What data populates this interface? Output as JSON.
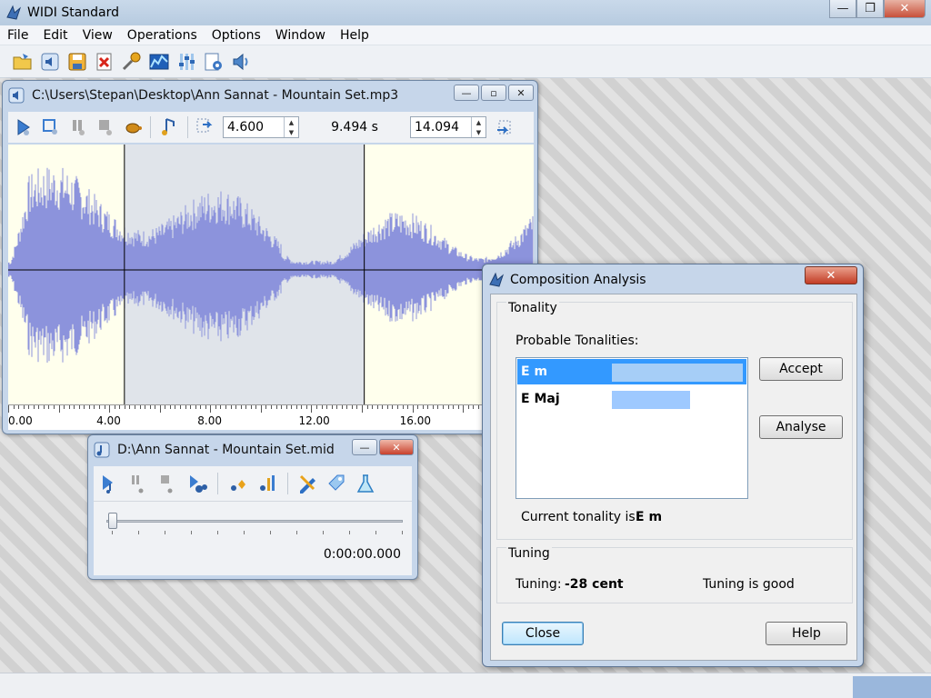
{
  "app": {
    "title": "WIDI Standard"
  },
  "window_buttons": {
    "minimize": "—",
    "maximize": "❐",
    "close": "✕"
  },
  "menu": [
    "File",
    "Edit",
    "View",
    "Operations",
    "Options",
    "Window",
    "Help"
  ],
  "toolbar_icons": [
    "open-folder-icon",
    "audio-speaker-icon",
    "save-icon",
    "delete-icon",
    "microphone-icon",
    "spectrum-icon",
    "equalizer-icon",
    "settings-doc-icon",
    "volume-icon"
  ],
  "audio_window": {
    "title": "C:\\Users\\Stepan\\Desktop\\Ann Sannat - Mountain Set.mp3",
    "start_value": "4.600",
    "duration_text": "9.494 s",
    "end_value": "14.094",
    "selection": {
      "start": 4.6,
      "end": 14.094,
      "max": 20.8
    },
    "ruler_labels": [
      "0.00",
      "4.00",
      "8.00",
      "12.00",
      "16.00"
    ],
    "ruler_label_values": [
      0,
      4,
      8,
      12,
      16
    ]
  },
  "midi_window": {
    "title": "D:\\Ann Sannat - Mountain Set.mid",
    "time": "0:00:00.000",
    "position": 0
  },
  "composition_dialog": {
    "title": "Composition Analysis",
    "close_glyph": "✕",
    "tonality_group": "Tonality",
    "probable_label": "Probable Tonalities:",
    "tonalities": [
      {
        "name": "E m",
        "score": 1.0,
        "selected": true
      },
      {
        "name": "E Maj",
        "score": 0.6,
        "selected": false
      }
    ],
    "accept_label": "Accept",
    "analyse_label": "Analyse",
    "current_label": "Current tonality is:",
    "current_value": "E m",
    "tuning_group": "Tuning",
    "tuning_label": "Tuning:",
    "tuning_value": "-28 cent",
    "tuning_status": "Tuning is good",
    "close_label": "Close",
    "help_label": "Help"
  },
  "colors": {
    "waveform": "#8c93dc",
    "selection": "#e0e4ea",
    "wave_bg": "#ffffed",
    "list_selected": "#3399ff"
  }
}
